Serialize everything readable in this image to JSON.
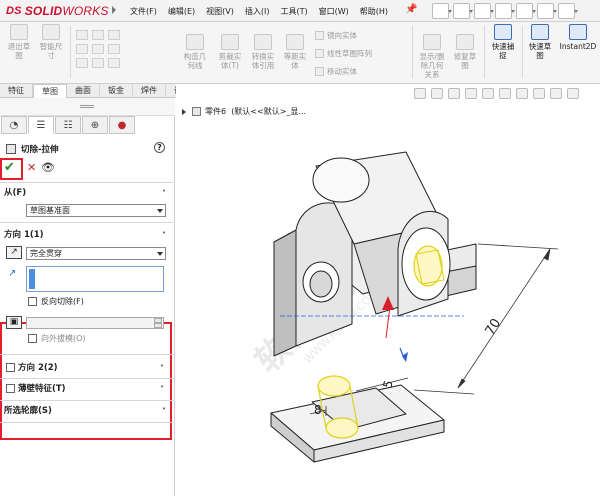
{
  "app": {
    "logo_prefix": "DS",
    "logo_solid": "SOLID",
    "logo_works": "WORKS",
    "brand_color": "#c8102e"
  },
  "menu": [
    "文件(F)",
    "编辑(E)",
    "视图(V)",
    "插入(I)",
    "工具(T)",
    "窗口(W)",
    "帮助(H)"
  ],
  "ribbon": {
    "exit_sketch": "退出草\n图",
    "smart_dim": "智能尺\n寸",
    "convert": "构造几\n何线",
    "trim": "剪裁实\n体(T)",
    "convert_entity": "转换实\n体引用",
    "offset": "等距实\n体",
    "mirror": "镜向实体",
    "linear_pattern": "线性草图阵列",
    "move": "移动实体",
    "show_relations": "显示/删\n除几何\n关系",
    "repair": "修复草\n图",
    "quick_snap": "快速捕\n捉",
    "quick_sketch": "快速草\n图",
    "instant2d": "Instant2D"
  },
  "tabs": [
    "特征",
    "草图",
    "曲面",
    "钣金",
    "焊件",
    "评估"
  ],
  "active_tab": "草图",
  "feature": {
    "title": "切除-拉伸",
    "from_label": "从(F)",
    "from_value": "草图基准面",
    "dir1_label": "方向 1(1)",
    "dir1_value": "完全贯穿",
    "reverse_cut": "反向切除(F)",
    "draft_partial": "向外拔模(O)",
    "dir2_label": "方向 2(2)",
    "thin_label": "薄壁特征(T)",
    "contours_label": "所选轮廓(S)"
  },
  "viewport": {
    "part_name": "零件6",
    "config": "(默认<<默认>_显..."
  },
  "dimensions": {
    "d70": "70",
    "d5": "5",
    "d8": "8"
  },
  "watermark": "软件自学网",
  "watermark_url": "WWW.RJZXW.COM"
}
